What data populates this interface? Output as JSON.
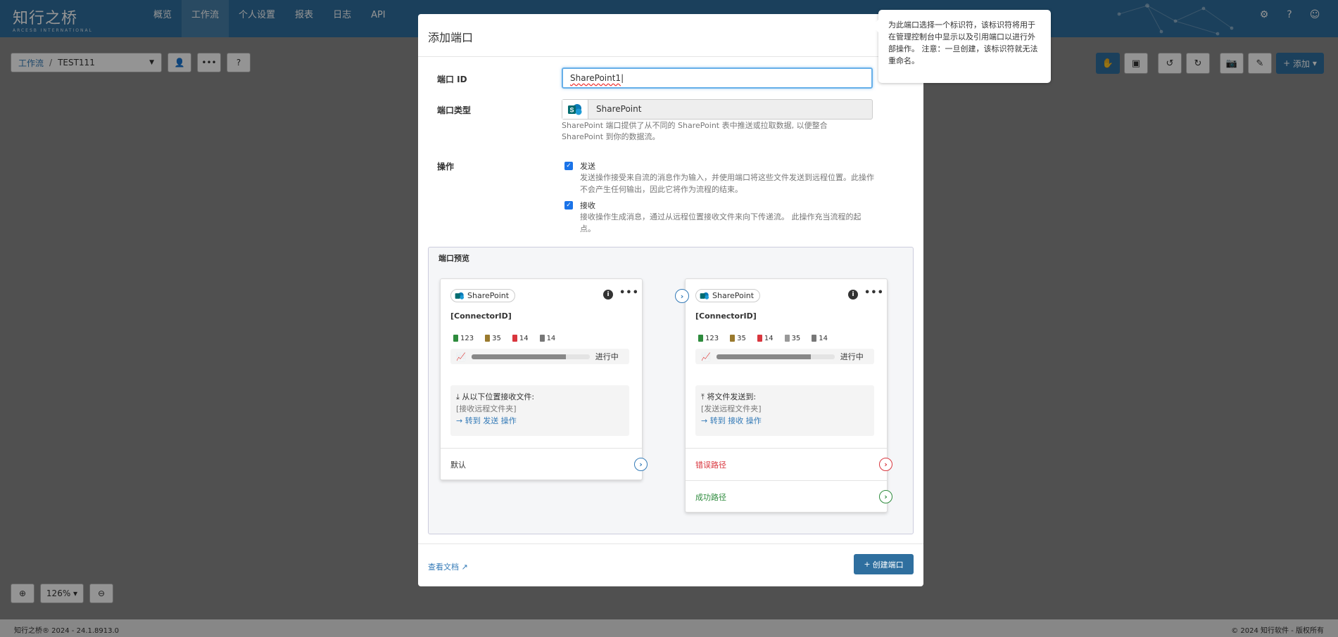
{
  "app": {
    "logo": "知行之桥",
    "logo_sub": "ARCESB INTERNATIONAL",
    "nav": [
      "概览",
      "工作流",
      "个人设置",
      "报表",
      "日志",
      "API"
    ],
    "active_nav": "工作流"
  },
  "toolbar": {
    "breadcrumb_root": "工作流",
    "breadcrumb_sep": "/",
    "breadcrumb_current": "TEST111",
    "add_label": "添加"
  },
  "zoom": {
    "level": "126%"
  },
  "footer": {
    "left": "知行之桥® 2024 - 24.1.8913.0",
    "right": "© 2024 知行软件 - 版权所有"
  },
  "modal": {
    "title": "添加端口",
    "connector_id_label": "端口 ID",
    "connector_id_value": "SharePoint1",
    "connector_type_label": "端口类型",
    "connector_type_value": "SharePoint",
    "type_help": "SharePoint 端口提供了从不同的 SharePoint 表中推送或拉取数据, 以便整合 SharePoint 到你的数据流。",
    "actions_label": "操作",
    "send": {
      "title": "发送",
      "desc": "发送操作接受来自流的消息作为输入，并使用端口将这些文件发送到远程位置。此操作不会产生任何输出，因此它将作为流程的结束。"
    },
    "receive": {
      "title": "接收",
      "desc": "接收操作生成消息，通过从远程位置接收文件来向下传递流。 此操作充当流程的起点。"
    },
    "preview_title": "端口预览",
    "doc_link": "查看文档",
    "create_button": "创建端口"
  },
  "preview": {
    "receive_card": {
      "chip": "SharePoint",
      "name": "[ConnectorID]",
      "stats": [
        {
          "value": "123",
          "color": "#2e8b3d"
        },
        {
          "value": "35",
          "color": "#9a7a2e"
        },
        {
          "value": "14",
          "color": "#d9363e"
        },
        {
          "value": "14",
          "color": "#777777"
        }
      ],
      "progress_label": "进行中",
      "progress": 0.8,
      "info_label": "从以下位置接收文件:",
      "info_path": "[接收远程文件夹]",
      "info_link": "→ 转到 发送 操作",
      "routes": [
        {
          "label": "默认",
          "color": "#333333"
        }
      ]
    },
    "send_card": {
      "chip": "SharePoint",
      "name": "[ConnectorID]",
      "stats": [
        {
          "value": "123",
          "color": "#2e8b3d"
        },
        {
          "value": "35",
          "color": "#9a7a2e"
        },
        {
          "value": "14",
          "color": "#d9363e"
        },
        {
          "value": "35",
          "color": "#999999"
        },
        {
          "value": "14",
          "color": "#777777"
        }
      ],
      "progress_label": "进行中",
      "progress": 0.8,
      "info_label": "将文件发送到:",
      "info_path": "[发送远程文件夹]",
      "info_link": "→ 转到 接收 操作",
      "routes": [
        {
          "label": "错误路径",
          "color": "#d9363e"
        },
        {
          "label": "成功路径",
          "color": "#2e8b3d"
        }
      ]
    }
  },
  "tooltip": {
    "text": "为此端口选择一个标识符，该标识符将用于在管理控制台中显示以及引用端口以进行外部操作。 注意：一旦创建，该标识符就无法重命名。"
  },
  "colors": {
    "nav": "#2f6f9f",
    "link": "#337ab7",
    "accent": "#1a73e8"
  }
}
